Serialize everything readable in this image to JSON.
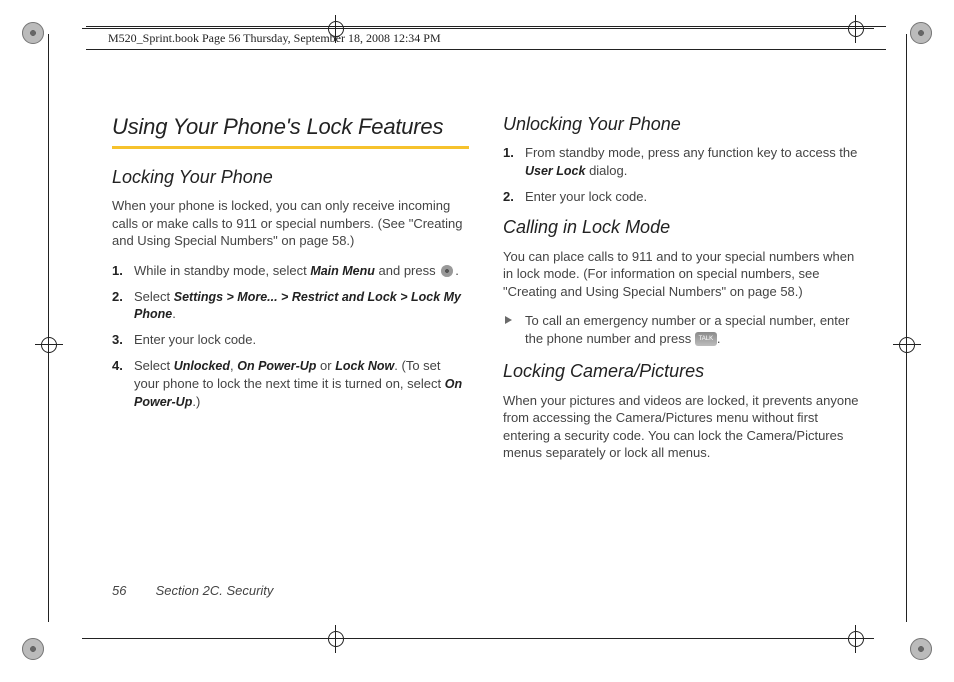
{
  "header": {
    "running": "M520_Sprint.book  Page 56  Thursday, September 18, 2008  12:34 PM"
  },
  "left": {
    "title": "Using Your Phone's Lock Features",
    "h2a": "Locking Your Phone",
    "p1": "When your phone is locked, you can only receive incoming calls or make calls to 911 or special numbers. (See \"Creating and Using Special Numbers\" on page 58.)",
    "s1a": "While in standby mode, select ",
    "s1b": "Main Menu",
    "s1c": " and press ",
    "s1d": ".",
    "s2a": "Select ",
    "s2b": "Settings > More... > Restrict and Lock > Lock My Phone",
    "s2c": ".",
    "s3": "Enter your lock code.",
    "s4a": "Select ",
    "s4b": "Unlocked",
    "s4c": ", ",
    "s4d": "On Power-Up",
    "s4e": " or ",
    "s4f": "Lock Now",
    "s4g": ". (To set your phone to lock the next time it is turned on, select ",
    "s4h": "On Power-Up",
    "s4i": ".)"
  },
  "right": {
    "h2a": "Unlocking Your Phone",
    "s1a": "From standby mode, press any function key to access the ",
    "s1b": "User Lock",
    "s1c": " dialog.",
    "s2": "Enter your lock code.",
    "h2b": "Calling in Lock Mode",
    "p1": "You can place calls to 911 and to your special numbers when in lock mode. (For information on special numbers, see \"Creating and Using Special Numbers\" on page 58.)",
    "b1a": "To call an emergency number or a special number, enter the phone number and press ",
    "b1b": ".",
    "h2c": "Locking Camera/Pictures",
    "p2": "When your pictures and videos are locked, it prevents anyone from accessing the Camera/Pictures menu without first entering a security code. You can lock the Camera/Pictures menus separately or lock all menus."
  },
  "footer": {
    "page": "56",
    "section": "Section 2C. Security"
  },
  "icons": {
    "talk": "TALK"
  }
}
